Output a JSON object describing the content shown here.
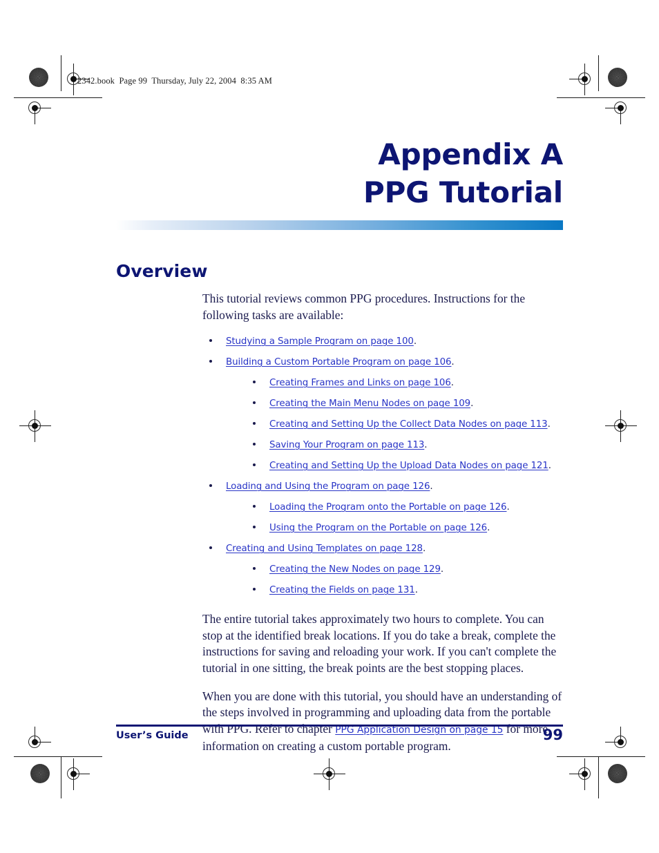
{
  "page": {
    "header_line": "2342.book  Page 99  Thursday, July 22, 2004  8:35 AM",
    "title_line_1": "Appendix A",
    "title_line_2": "PPG Tutorial",
    "section_heading": "Overview",
    "intro_paragraph": "This tutorial reviews common PPG procedures. Instructions for the following tasks are available:",
    "closing_paragraph_1": "The entire tutorial takes approximately two hours to complete. You can stop at the identified break locations. If you do take a break, complete the instructions for saving and reloading your work. If you can't complete the tutorial in one sitting, the break points are the best stopping places.",
    "closing_paragraph_2_before": "When you are done with this tutorial, you should have an understanding of the steps involved in programming and uploading data from the portable with PPG. Refer to chapter ",
    "closing_paragraph_2_link": "PPG Application Design on page 15",
    "closing_paragraph_2_after": " for more information on creating a custom portable program."
  },
  "toc": {
    "items": [
      {
        "link": "Studying a Sample Program on page 100",
        "trailing": ".",
        "children": []
      },
      {
        "link": "Building a Custom Portable Program on page 106",
        "trailing": ".",
        "children": [
          {
            "link": "Creating Frames and Links on page 106",
            "trailing": "."
          },
          {
            "link": "Creating the Main Menu Nodes on page 109",
            "trailing": "."
          },
          {
            "link": "Creating and Setting Up the Collect Data Nodes on page 113",
            "trailing": "."
          },
          {
            "link": "Saving Your Program on page 113",
            "trailing": "."
          },
          {
            "link": "Creating and Setting Up the Upload Data Nodes on page 121",
            "trailing": "."
          }
        ]
      },
      {
        "link": "Loading and Using the Program on page 126",
        "trailing": ".",
        "children": [
          {
            "link": "Loading the Program onto the Portable on page 126",
            "trailing": "."
          },
          {
            "link": "Using the Program on the Portable on page 126",
            "trailing": "."
          }
        ]
      },
      {
        "link": "Creating and Using Templates on page 128",
        "trailing": ".",
        "children": [
          {
            "link": "Creating the New Nodes on page 129",
            "trailing": "."
          },
          {
            "link": "Creating the Fields on page 131",
            "trailing": "."
          }
        ]
      }
    ]
  },
  "footer": {
    "left_label": "User’s Guide",
    "page_number": "99"
  },
  "colors": {
    "title_navy": "#0d1573",
    "link_blue": "#2733c6",
    "body_navy": "#1b1b4e",
    "rule_blue_end": "#0a78c4"
  }
}
